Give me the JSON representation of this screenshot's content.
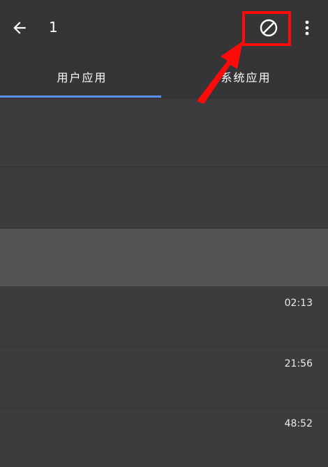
{
  "toolbar": {
    "back_icon": "arrow-left-icon",
    "title": "1",
    "block_icon": "block-icon",
    "more_icon": "more-vert-icon",
    "highlight_color": "#ff0a0a"
  },
  "tabs": [
    {
      "label": "用户应用",
      "active": true
    },
    {
      "label": "系统应用",
      "active": false
    }
  ],
  "accent_color": "#5b8ff9",
  "list": {
    "rows": [
      {
        "time": ""
      },
      {
        "time": ""
      },
      {
        "time": ""
      },
      {
        "time": "02:13"
      },
      {
        "time": "21:56"
      },
      {
        "time": "48:52"
      }
    ]
  }
}
